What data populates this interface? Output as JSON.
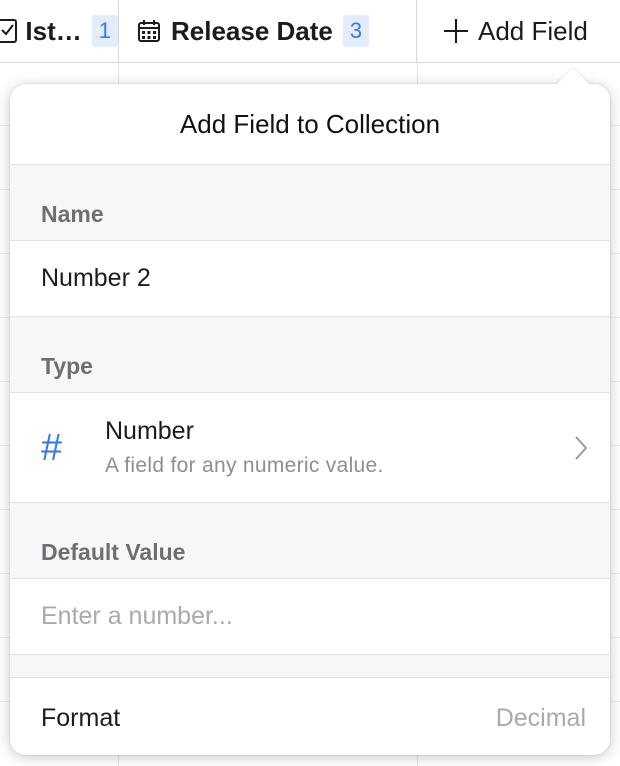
{
  "table_header": {
    "col1": {
      "label": "Ist…",
      "badge": "1"
    },
    "col2": {
      "label": "Release Date",
      "badge": "3"
    },
    "add_field": {
      "label": "Add Field"
    }
  },
  "popover": {
    "title": "Add Field to Collection",
    "name_section": {
      "label": "Name",
      "value": "Number 2"
    },
    "type_section": {
      "label": "Type",
      "icon": "hash-icon",
      "title": "Number",
      "description": "A field for any numeric value."
    },
    "default_section": {
      "label": "Default Value",
      "placeholder": "Enter a number..."
    },
    "format": {
      "label": "Format",
      "value": "Decimal"
    }
  },
  "colors": {
    "accent": "#2f7ae5",
    "badge_bg": "#e2ecfb",
    "badge_text": "#3b7bdc"
  }
}
